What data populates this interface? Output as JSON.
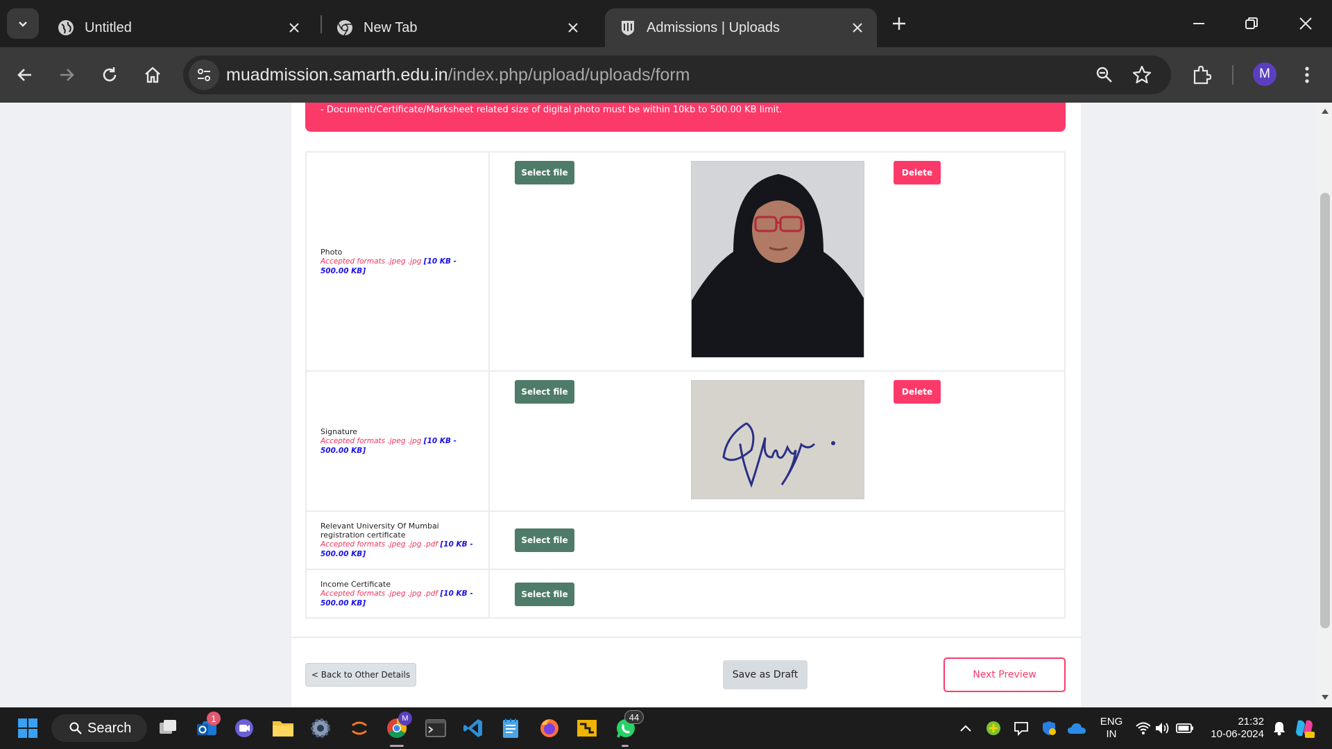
{
  "browser": {
    "tabs": [
      {
        "title": "Untitled",
        "icon": "globe-icon"
      },
      {
        "title": "New Tab",
        "icon": "chrome-icon"
      },
      {
        "title": "Admissions | Uploads",
        "icon": "university-crest-icon"
      }
    ],
    "url_host": "muadmission.samarth.edu.in",
    "url_path": "/index.php/upload/uploads/form",
    "profile_initial": "M"
  },
  "page": {
    "alert_text": "- Document/Certificate/Marksheet related size of digital photo must be within 10kb to 500.00 KB limit.",
    "documents": [
      {
        "name": "Photo",
        "formats": "Accepted formats .jpeg .jpg",
        "size": "[10 KB - 500.00 KB]",
        "select_label": "Select file",
        "delete_label": "Delete",
        "uploaded": "photo"
      },
      {
        "name": "Signature",
        "formats": "Accepted formats .jpeg .jpg",
        "size": "[10 KB - 500.00 KB]",
        "select_label": "Select file",
        "delete_label": "Delete",
        "uploaded": "signature"
      },
      {
        "name": "Relevant University Of Mumbai registration certificate",
        "formats": "Accepted formats .jpeg .jpg .pdf",
        "size": "[10 KB - 500.00 KB]",
        "select_label": "Select file"
      },
      {
        "name": "Income Certificate",
        "formats": "Accepted formats .jpeg .jpg .pdf",
        "size": "[10 KB - 500.00 KB]",
        "select_label": "Select file"
      }
    ],
    "back_label": "< Back to Other Details",
    "draft_label": "Save as Draft",
    "next_label": "Next Preview"
  },
  "taskbar": {
    "search_label": "Search",
    "outlook_badge": "1",
    "whatsapp_badge": "44",
    "lang_top": "ENG",
    "lang_bottom": "IN",
    "time": "21:32",
    "date": "10-06-2024"
  },
  "colors": {
    "accent_pink": "#fc3a6a",
    "select_green": "#4e7c68",
    "format_blue": "#1a10e6"
  }
}
